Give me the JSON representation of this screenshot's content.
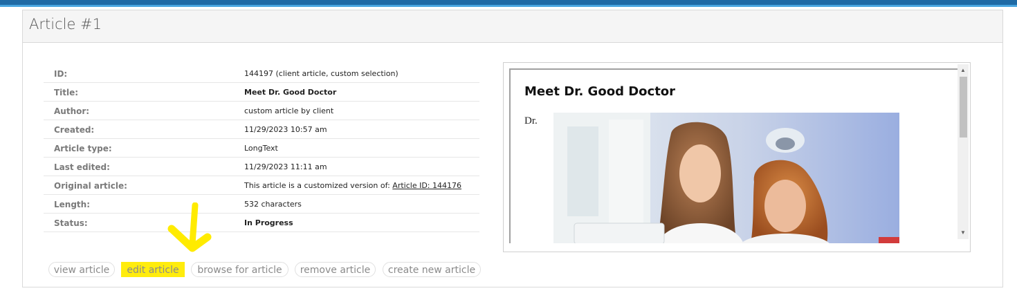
{
  "panel": {
    "title": "Article #1"
  },
  "details": [
    {
      "label": "ID:",
      "value": "144197 (client article, custom selection)",
      "bold": false
    },
    {
      "label": "Title:",
      "value": "Meet Dr. Good Doctor",
      "bold": true
    },
    {
      "label": "Author:",
      "value": "custom article by client",
      "bold": false
    },
    {
      "label": "Created:",
      "value": "11/29/2023 10:57 am",
      "bold": false
    },
    {
      "label": "Article type:",
      "value": "LongText",
      "bold": false
    },
    {
      "label": "Last edited:",
      "value": "11/29/2023 11:11 am",
      "bold": false
    },
    {
      "label": "Original article:",
      "value": "This article is a customized version of:",
      "link": "Article ID: 144176",
      "bold": false
    },
    {
      "label": "Length:",
      "value": "532 characters",
      "bold": false
    },
    {
      "label": "Status:",
      "value": "In Progress",
      "bold": true
    }
  ],
  "buttons": {
    "view": "view article",
    "edit": "edit article",
    "browse": "browse for article",
    "remove": "remove article",
    "create": "create new article"
  },
  "preview": {
    "title": "Meet Dr. Good Doctor",
    "text": "Dr."
  },
  "colors": {
    "accent": "#2b8fd3",
    "highlight": "#ffeb00"
  }
}
